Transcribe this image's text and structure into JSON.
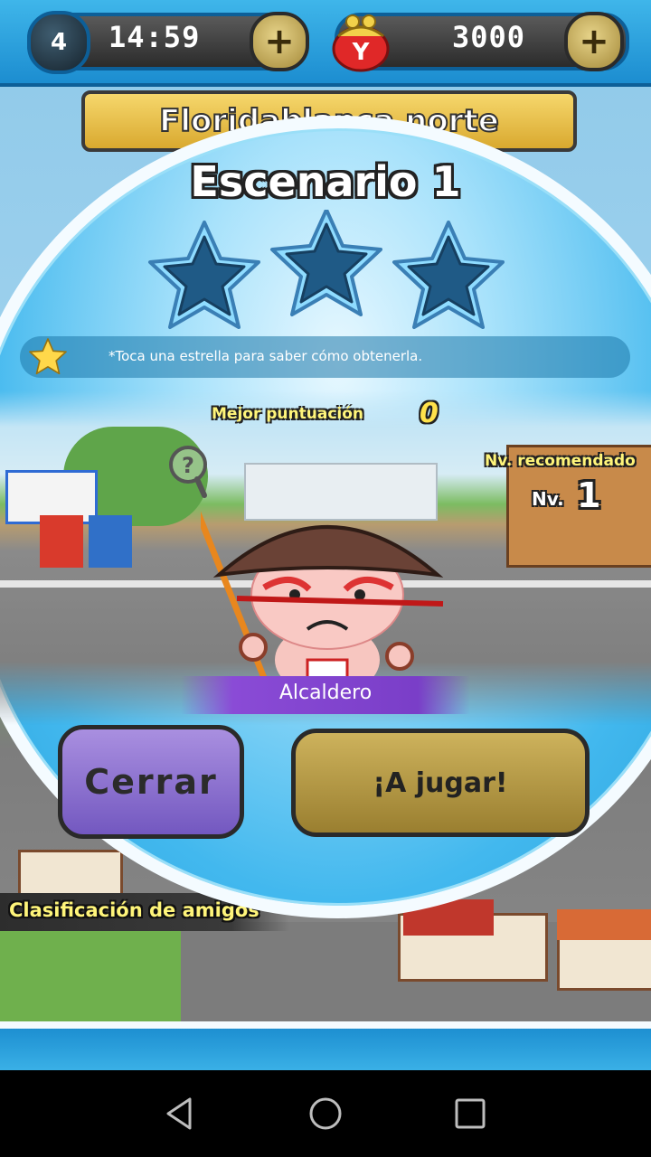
{
  "topbar": {
    "stamina_count": "4",
    "timer": "14:59",
    "money": "3000",
    "plus_label": "+",
    "purse_letter": "Y"
  },
  "banner": {
    "title": "Floridablanca norte"
  },
  "modal": {
    "title": "Escenario",
    "title_number": "1",
    "stars": [
      {
        "earned": false
      },
      {
        "earned": false
      },
      {
        "earned": false
      }
    ],
    "tip": "*Toca una estrella para saber cómo obtenerla.",
    "best_score_label": "Mejor puntuación",
    "best_score_value": "0",
    "recommended_label": "Nv. recomendado",
    "level_prefix": "Nv.",
    "level_value": "1",
    "help_symbol": "?",
    "enemy_name": "Alcaldero",
    "close_label": "Cerrar",
    "play_label": "¡A jugar!"
  },
  "friends": {
    "label": "Clasificación de amigos"
  },
  "colors": {
    "topbar_blue": "#1c8dd0",
    "star_fill": "#1f5a86",
    "close_button": "#8a6fd2",
    "play_button": "#b89a45",
    "label_yellow": "#fff57a"
  },
  "nav": {
    "icons": [
      "back-triangle-icon",
      "home-circle-icon",
      "recents-square-icon"
    ]
  }
}
